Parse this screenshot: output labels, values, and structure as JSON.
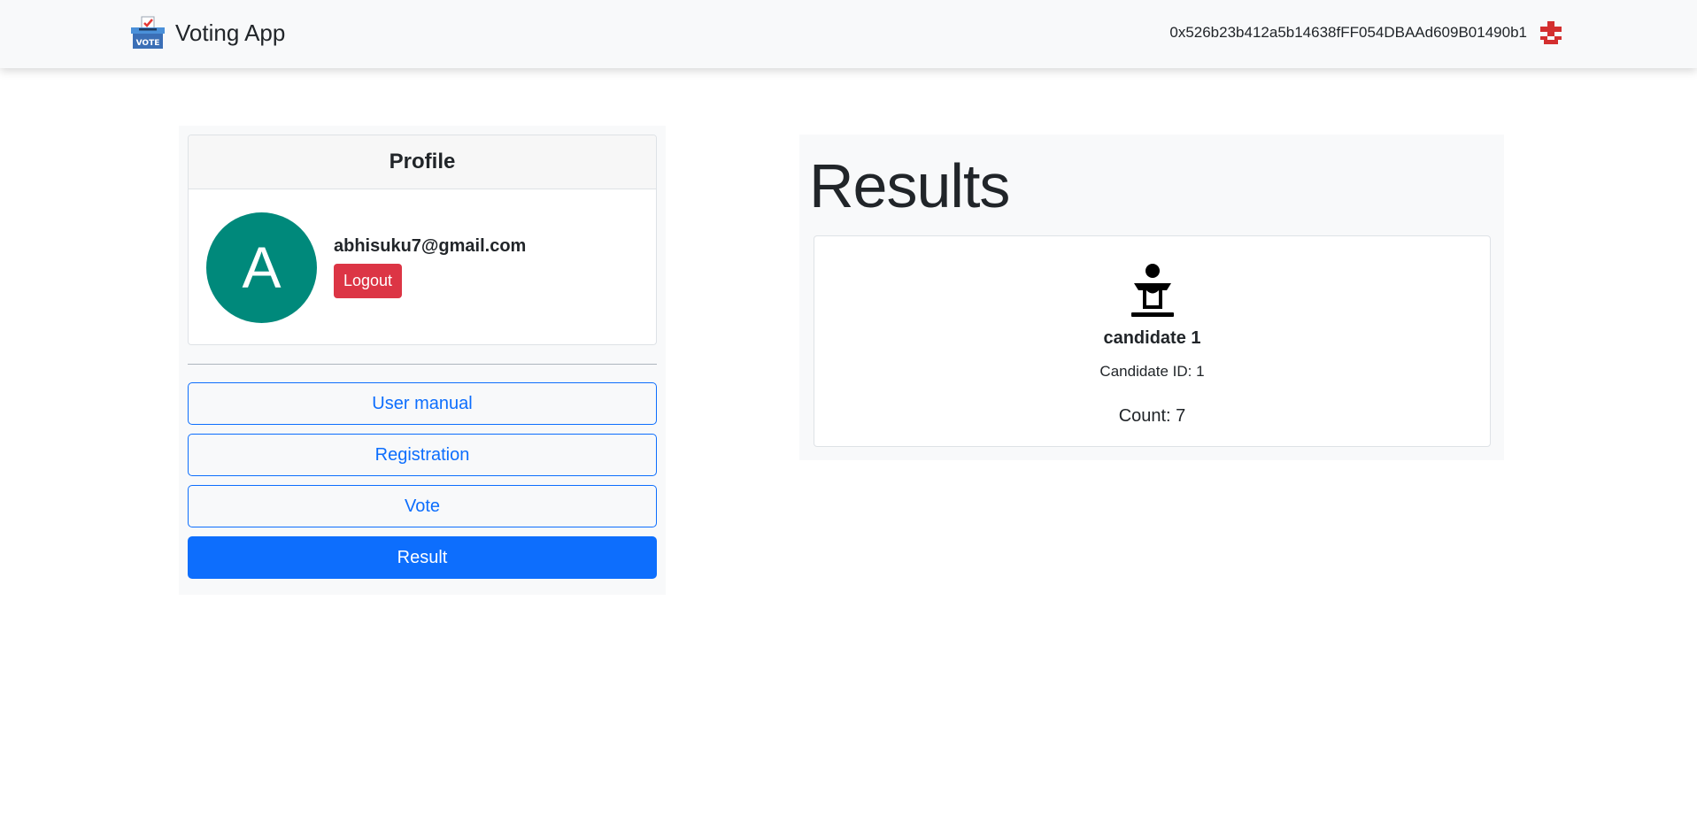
{
  "navbar": {
    "brand_icon": "vote-ballot-box-icon",
    "brand_title": "Voting App",
    "account_address": "0x526b23b412a5b14638fFF054DBAAd609B01490b1",
    "account_icon": "identicon-icon"
  },
  "profile": {
    "header": "Profile",
    "avatar_letter": "A",
    "email": "abhisuku7@gmail.com",
    "logout_label": "Logout"
  },
  "nav": {
    "items": [
      {
        "label": "User manual",
        "active": false
      },
      {
        "label": "Registration",
        "active": false
      },
      {
        "label": "Vote",
        "active": false
      },
      {
        "label": "Result",
        "active": true
      }
    ]
  },
  "results": {
    "title": "Results",
    "candidates": [
      {
        "icon": "podium-speaker-icon",
        "name": "candidate 1",
        "id_text": "Candidate ID: 1",
        "count_text": "Count: 7"
      }
    ]
  },
  "colors": {
    "primary": "#0d6efd",
    "danger": "#dc3545",
    "avatar": "#00897b",
    "panel": "#f8f9fa"
  }
}
